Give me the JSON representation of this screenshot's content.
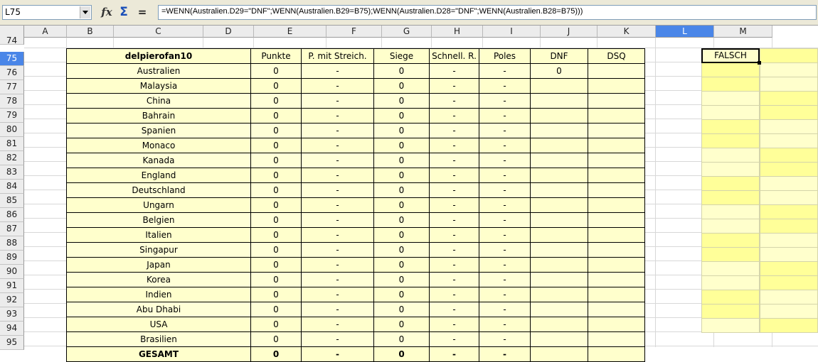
{
  "namebox": "L75",
  "formula": "=WENN(Australien.D29=\"DNF\";WENN(Australien.B29=B75);WENN(Australien.D28=\"DNF\";WENN(Australien.B28=B75)))",
  "columns": [
    "A",
    "B",
    "C",
    "D",
    "E",
    "F",
    "G",
    "H",
    "I",
    "J",
    "K",
    "L",
    "M"
  ],
  "rows": [
    "74",
    "75",
    "76",
    "77",
    "78",
    "79",
    "80",
    "81",
    "82",
    "83",
    "84",
    "85",
    "86",
    "87",
    "88",
    "89",
    "90",
    "91",
    "92",
    "93",
    "94",
    "95"
  ],
  "table": {
    "headers": [
      "delpierofan10",
      "Punkte",
      "P. mit Streich.",
      "Siege",
      "Schnell. R.",
      "Poles",
      "DNF",
      "DSQ"
    ],
    "rows": [
      [
        "Australien",
        "0",
        "-",
        "0",
        "-",
        "-",
        "0",
        ""
      ],
      [
        "Malaysia",
        "0",
        "-",
        "0",
        "-",
        "-",
        "",
        ""
      ],
      [
        "China",
        "0",
        "-",
        "0",
        "-",
        "-",
        "",
        ""
      ],
      [
        "Bahrain",
        "0",
        "-",
        "0",
        "-",
        "-",
        "",
        ""
      ],
      [
        "Spanien",
        "0",
        "-",
        "0",
        "-",
        "-",
        "",
        ""
      ],
      [
        "Monaco",
        "0",
        "-",
        "0",
        "-",
        "-",
        "",
        ""
      ],
      [
        "Kanada",
        "0",
        "-",
        "0",
        "-",
        "-",
        "",
        ""
      ],
      [
        "England",
        "0",
        "-",
        "0",
        "-",
        "-",
        "",
        ""
      ],
      [
        "Deutschland",
        "0",
        "-",
        "0",
        "-",
        "-",
        "",
        ""
      ],
      [
        "Ungarn",
        "0",
        "-",
        "0",
        "-",
        "-",
        "",
        ""
      ],
      [
        "Belgien",
        "0",
        "-",
        "0",
        "-",
        "-",
        "",
        ""
      ],
      [
        "Italien",
        "0",
        "-",
        "0",
        "-",
        "-",
        "",
        ""
      ],
      [
        "Singapur",
        "0",
        "-",
        "0",
        "-",
        "-",
        "",
        ""
      ],
      [
        "Japan",
        "0",
        "-",
        "0",
        "-",
        "-",
        "",
        ""
      ],
      [
        "Korea",
        "0",
        "-",
        "0",
        "-",
        "-",
        "",
        ""
      ],
      [
        "Indien",
        "0",
        "-",
        "0",
        "-",
        "-",
        "",
        ""
      ],
      [
        "Abu Dhabi",
        "0",
        "-",
        "0",
        "-",
        "-",
        "",
        ""
      ],
      [
        "USA",
        "0",
        "-",
        "0",
        "-",
        "-",
        "",
        ""
      ],
      [
        "Brasilien",
        "0",
        "-",
        "0",
        "-",
        "-",
        "",
        ""
      ]
    ],
    "total": [
      "GESAMT",
      "0",
      "-",
      "0",
      "-",
      "-",
      "",
      ""
    ]
  },
  "cell_L75": "FALSCH",
  "colors": {
    "selection": "#4a86e8",
    "cell_light": "#ffffcc",
    "cell_yellow": "#ffff99"
  }
}
